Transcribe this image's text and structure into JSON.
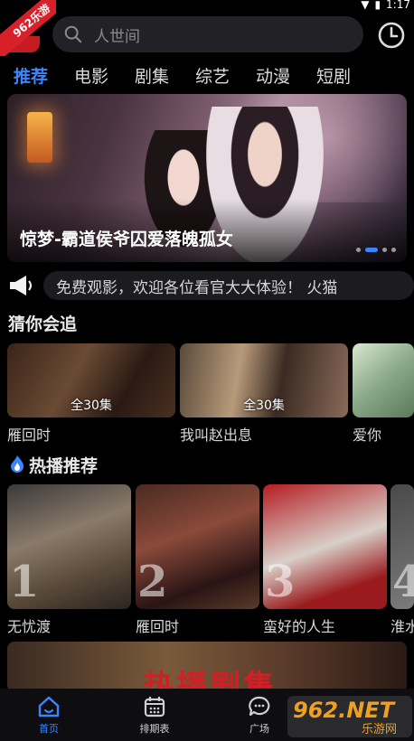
{
  "status": {
    "time": "1:17"
  },
  "corner_badge": "962乐游",
  "search": {
    "placeholder": "人世间"
  },
  "tabs": [
    {
      "label": "推荐",
      "active": true
    },
    {
      "label": "电影"
    },
    {
      "label": "剧集"
    },
    {
      "label": "综艺"
    },
    {
      "label": "动漫"
    },
    {
      "label": "短剧"
    }
  ],
  "banner": {
    "title": "惊梦-霸道侯爷囚爱落魄孤女",
    "dot_count": 4,
    "active_dot": 1
  },
  "notice": {
    "text": "免费观影，欢迎各位看官大大体验！   火猫"
  },
  "guess": {
    "title": "猜你会追",
    "items": [
      {
        "name": "雁回时",
        "episodes": "全30集"
      },
      {
        "name": "我叫赵出息",
        "episodes": "全30集"
      },
      {
        "name": "爱你",
        "episodes": ""
      }
    ]
  },
  "hot": {
    "title": "热播推荐",
    "items": [
      {
        "rank": "1",
        "name": "无忧渡"
      },
      {
        "rank": "2",
        "name": "雁回时"
      },
      {
        "rank": "3",
        "name": "蛮好的人生"
      },
      {
        "rank": "4",
        "name": "淮水"
      }
    ]
  },
  "promo": {
    "text": "热播剧集"
  },
  "tabbar": [
    {
      "label": "首页",
      "active": true
    },
    {
      "label": "排期表"
    },
    {
      "label": "广场"
    }
  ],
  "watermark": {
    "line1": "962.NET",
    "line2": "乐游网"
  },
  "colors": {
    "accent": "#3a86ff",
    "bg": "#000000",
    "badge": "#d8202a"
  }
}
